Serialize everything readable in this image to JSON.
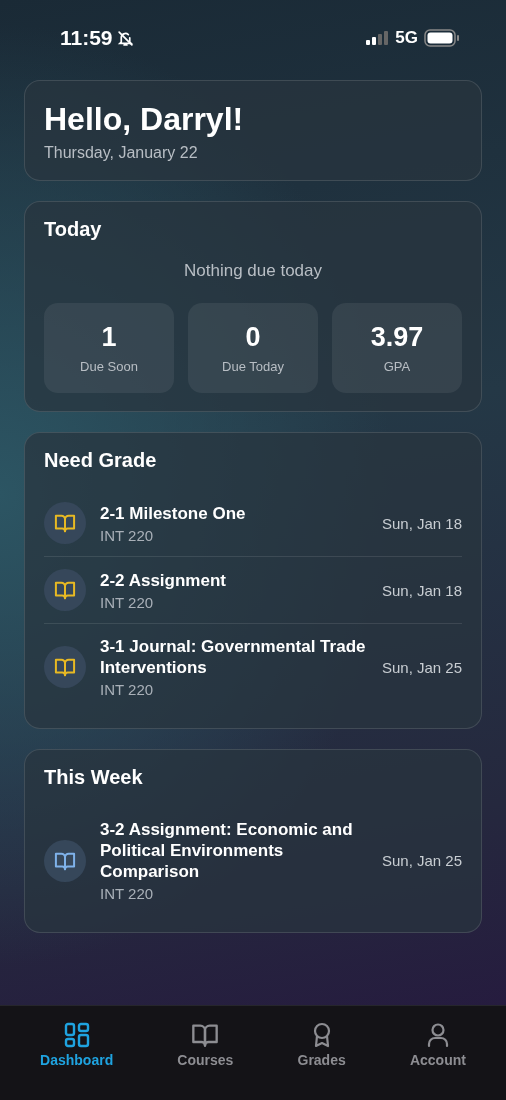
{
  "status_bar": {
    "time": "11:59",
    "network": "5G"
  },
  "greeting": {
    "title": "Hello, Darryl!",
    "date": "Thursday, January 22"
  },
  "today": {
    "title": "Today",
    "message": "Nothing due today",
    "stats": [
      {
        "value": "1",
        "label": "Due Soon"
      },
      {
        "value": "0",
        "label": "Due Today"
      },
      {
        "value": "3.97",
        "label": "GPA"
      }
    ]
  },
  "need_grade": {
    "title": "Need Grade",
    "items": [
      {
        "title": "2-1 Milestone One",
        "course": "INT 220",
        "date": "Sun, Jan 18",
        "color": "#e8b923"
      },
      {
        "title": "2-2 Assignment",
        "course": "INT 220",
        "date": "Sun, Jan 18",
        "color": "#e8b923"
      },
      {
        "title": "3-1 Journal: Governmental Trade Interventions",
        "course": "INT 220",
        "date": "Sun, Jan 25",
        "color": "#e8b923"
      }
    ]
  },
  "this_week": {
    "title": "This Week",
    "items": [
      {
        "title": "3-2 Assignment: Economic and Political Environments Comparison",
        "course": "INT 220",
        "date": "Sun, Jan 25",
        "color": "#7fb2ea"
      }
    ]
  },
  "tab_bar": [
    {
      "kind": "dashboard",
      "label": "Dashboard",
      "selected": true
    },
    {
      "kind": "courses",
      "label": "Courses",
      "selected": false
    },
    {
      "kind": "grades",
      "label": "Grades",
      "selected": false
    },
    {
      "kind": "account",
      "label": "Account",
      "selected": false
    }
  ]
}
